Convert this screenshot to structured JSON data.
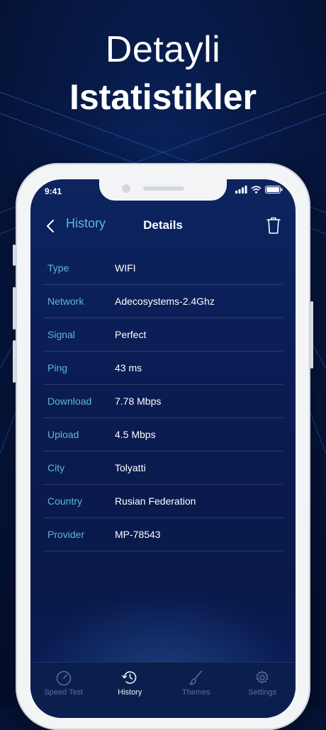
{
  "headline": {
    "line1": "Detayli",
    "line2": "Istatistikler"
  },
  "status_bar": {
    "time": "9:41"
  },
  "nav": {
    "back_label": "History",
    "title": "Details"
  },
  "details": [
    {
      "key": "Type",
      "value": "WIFI"
    },
    {
      "key": "Network",
      "value": "Adecosystems-2.4Ghz"
    },
    {
      "key": "Signal",
      "value": "Perfect"
    },
    {
      "key": "Ping",
      "value": "43 ms"
    },
    {
      "key": "Download",
      "value": "7.78 Mbps"
    },
    {
      "key": "Upload",
      "value": "4.5 Mbps"
    },
    {
      "key": "City",
      "value": "Tolyatti"
    },
    {
      "key": "Country",
      "value": "Rusian Federation"
    },
    {
      "key": "Provider",
      "value": "MP-78543"
    }
  ],
  "tabs": [
    {
      "label": "Speed Test",
      "icon": "speedometer-icon",
      "active": false
    },
    {
      "label": "History",
      "icon": "history-icon",
      "active": true
    },
    {
      "label": "Themes",
      "icon": "brush-icon",
      "active": false
    },
    {
      "label": "Settings",
      "icon": "gear-icon",
      "active": false
    }
  ],
  "colors": {
    "accent": "#5fb6d6",
    "background": "#071a48"
  }
}
